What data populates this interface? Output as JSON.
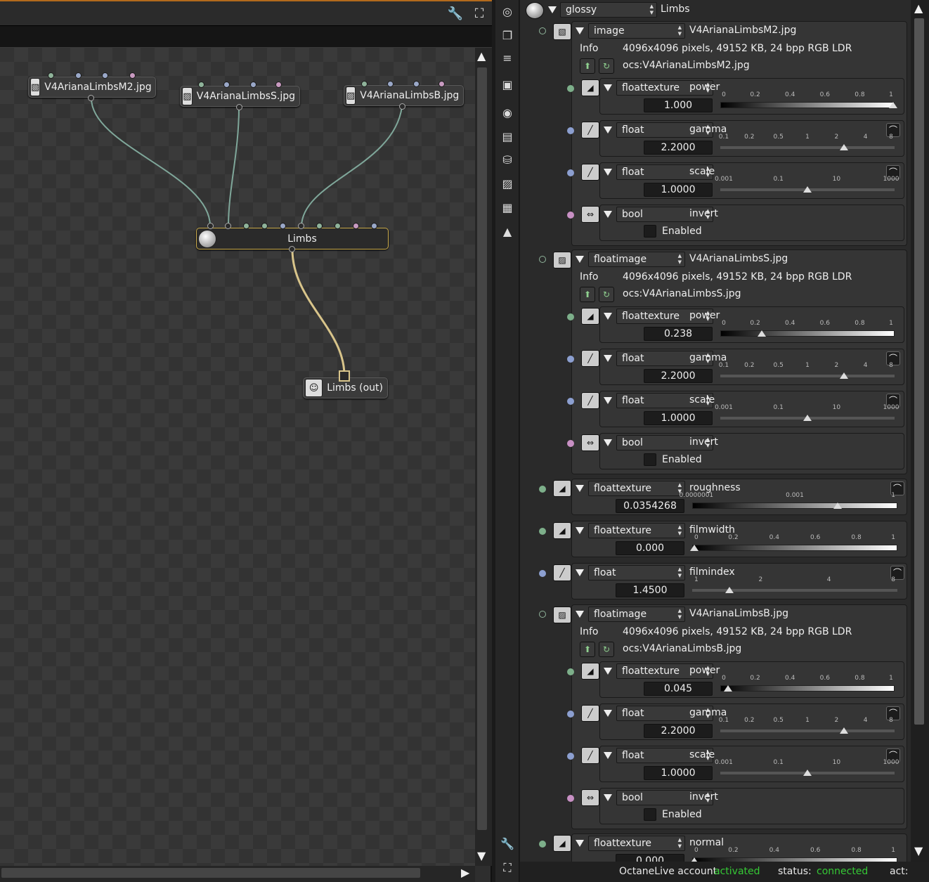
{
  "node_editor": {
    "nodes": {
      "texM2": {
        "label": "V4ArianaLimbsM2.jpg"
      },
      "texS": {
        "label": "V4ArianaLimbsS.jpg"
      },
      "texB": {
        "label": "V4ArianaLimbsB.jpg"
      },
      "material": {
        "label": "Limbs"
      },
      "output": {
        "label": "Limbs (out)"
      }
    }
  },
  "inspector": {
    "header": {
      "type": "glossy",
      "name": "Limbs"
    },
    "info_label": "Info",
    "enabled_label": "Enabled",
    "m2": {
      "type": "image",
      "name": "V4ArianaLimbsM2.jpg",
      "info": "4096x4096 pixels, 49152 KB, 24 bpp RGB LDR",
      "path": "ocs:V4ArianaLimbsM2.jpg",
      "power": {
        "type": "floattexture",
        "name": "power",
        "value": "1.000",
        "ticks": [
          "0",
          "0.2",
          "0.4",
          "0.6",
          "0.8",
          "1"
        ],
        "fraction": 1.0
      },
      "gamma": {
        "type": "float",
        "name": "gamma",
        "value": "2.2000",
        "ticks": [
          "0.1",
          "0.2",
          "0.5",
          "1",
          "2",
          "4",
          "8"
        ],
        "fraction": 0.71
      },
      "scale": {
        "type": "float",
        "name": "scale",
        "value": "1.0000",
        "ticks": [
          "0.001",
          "0.1",
          "10",
          "1000"
        ],
        "fraction": 0.5
      },
      "invert": {
        "type": "bool",
        "name": "invert"
      }
    },
    "s": {
      "type": "floatimage",
      "name": "V4ArianaLimbsS.jpg",
      "info": "4096x4096 pixels, 49152 KB, 24 bpp RGB LDR",
      "path": "ocs:V4ArianaLimbsS.jpg",
      "power": {
        "type": "floattexture",
        "name": "power",
        "value": "0.238",
        "ticks": [
          "0",
          "0.2",
          "0.4",
          "0.6",
          "0.8",
          "1"
        ],
        "fraction": 0.238
      },
      "gamma": {
        "type": "float",
        "name": "gamma",
        "value": "2.2000",
        "ticks": [
          "0.1",
          "0.2",
          "0.5",
          "1",
          "2",
          "4",
          "8"
        ],
        "fraction": 0.71
      },
      "scale": {
        "type": "float",
        "name": "scale",
        "value": "1.0000",
        "ticks": [
          "0.001",
          "0.1",
          "10",
          "1000"
        ],
        "fraction": 0.5
      },
      "invert": {
        "type": "bool",
        "name": "invert"
      }
    },
    "roughness": {
      "type": "floattexture",
      "name": "roughness",
      "value": "0.0354268",
      "ticks": [
        "0.0000001",
        "0.001",
        "1"
      ],
      "fraction": 0.71
    },
    "filmwidth": {
      "type": "floattexture",
      "name": "filmwidth",
      "value": "0.000",
      "ticks": [
        "0",
        "0.2",
        "0.4",
        "0.6",
        "0.8",
        "1"
      ],
      "fraction": 0.0
    },
    "filmindex": {
      "type": "float",
      "name": "filmindex",
      "value": "1.4500",
      "ticks": [
        "1",
        "2",
        "4",
        "8"
      ],
      "fraction": 0.18
    },
    "b": {
      "type": "floatimage",
      "name": "V4ArianaLimbsB.jpg",
      "info": "4096x4096 pixels, 49152 KB, 24 bpp RGB LDR",
      "path": "ocs:V4ArianaLimbsB.jpg",
      "power": {
        "type": "floattexture",
        "name": "power",
        "value": "0.045",
        "ticks": [
          "0",
          "0.2",
          "0.4",
          "0.6",
          "0.8",
          "1"
        ],
        "fraction": 0.045
      },
      "gamma": {
        "type": "float",
        "name": "gamma",
        "value": "2.2000",
        "ticks": [
          "0.1",
          "0.2",
          "0.5",
          "1",
          "2",
          "4",
          "8"
        ],
        "fraction": 0.71
      },
      "scale": {
        "type": "float",
        "name": "scale",
        "value": "1.0000",
        "ticks": [
          "0.001",
          "0.1",
          "10",
          "1000"
        ],
        "fraction": 0.5
      },
      "invert": {
        "type": "bool",
        "name": "invert"
      }
    },
    "normal": {
      "type": "floattexture",
      "name": "normal",
      "value": "0.000",
      "ticks": [
        "0",
        "0.2",
        "0.4",
        "0.6",
        "0.8",
        "1"
      ],
      "fraction": 0.0
    }
  },
  "statusbar": {
    "account_label": "OctaneLive account:",
    "account_value": "activated",
    "status_label": "status:",
    "status_value": "connected",
    "act_label": "act:"
  },
  "colors": {
    "accent_orange": "#b36a1c",
    "status_green": "#35c835",
    "wire_teal": "#7fa79a",
    "wire_gold": "#d8c48a"
  }
}
